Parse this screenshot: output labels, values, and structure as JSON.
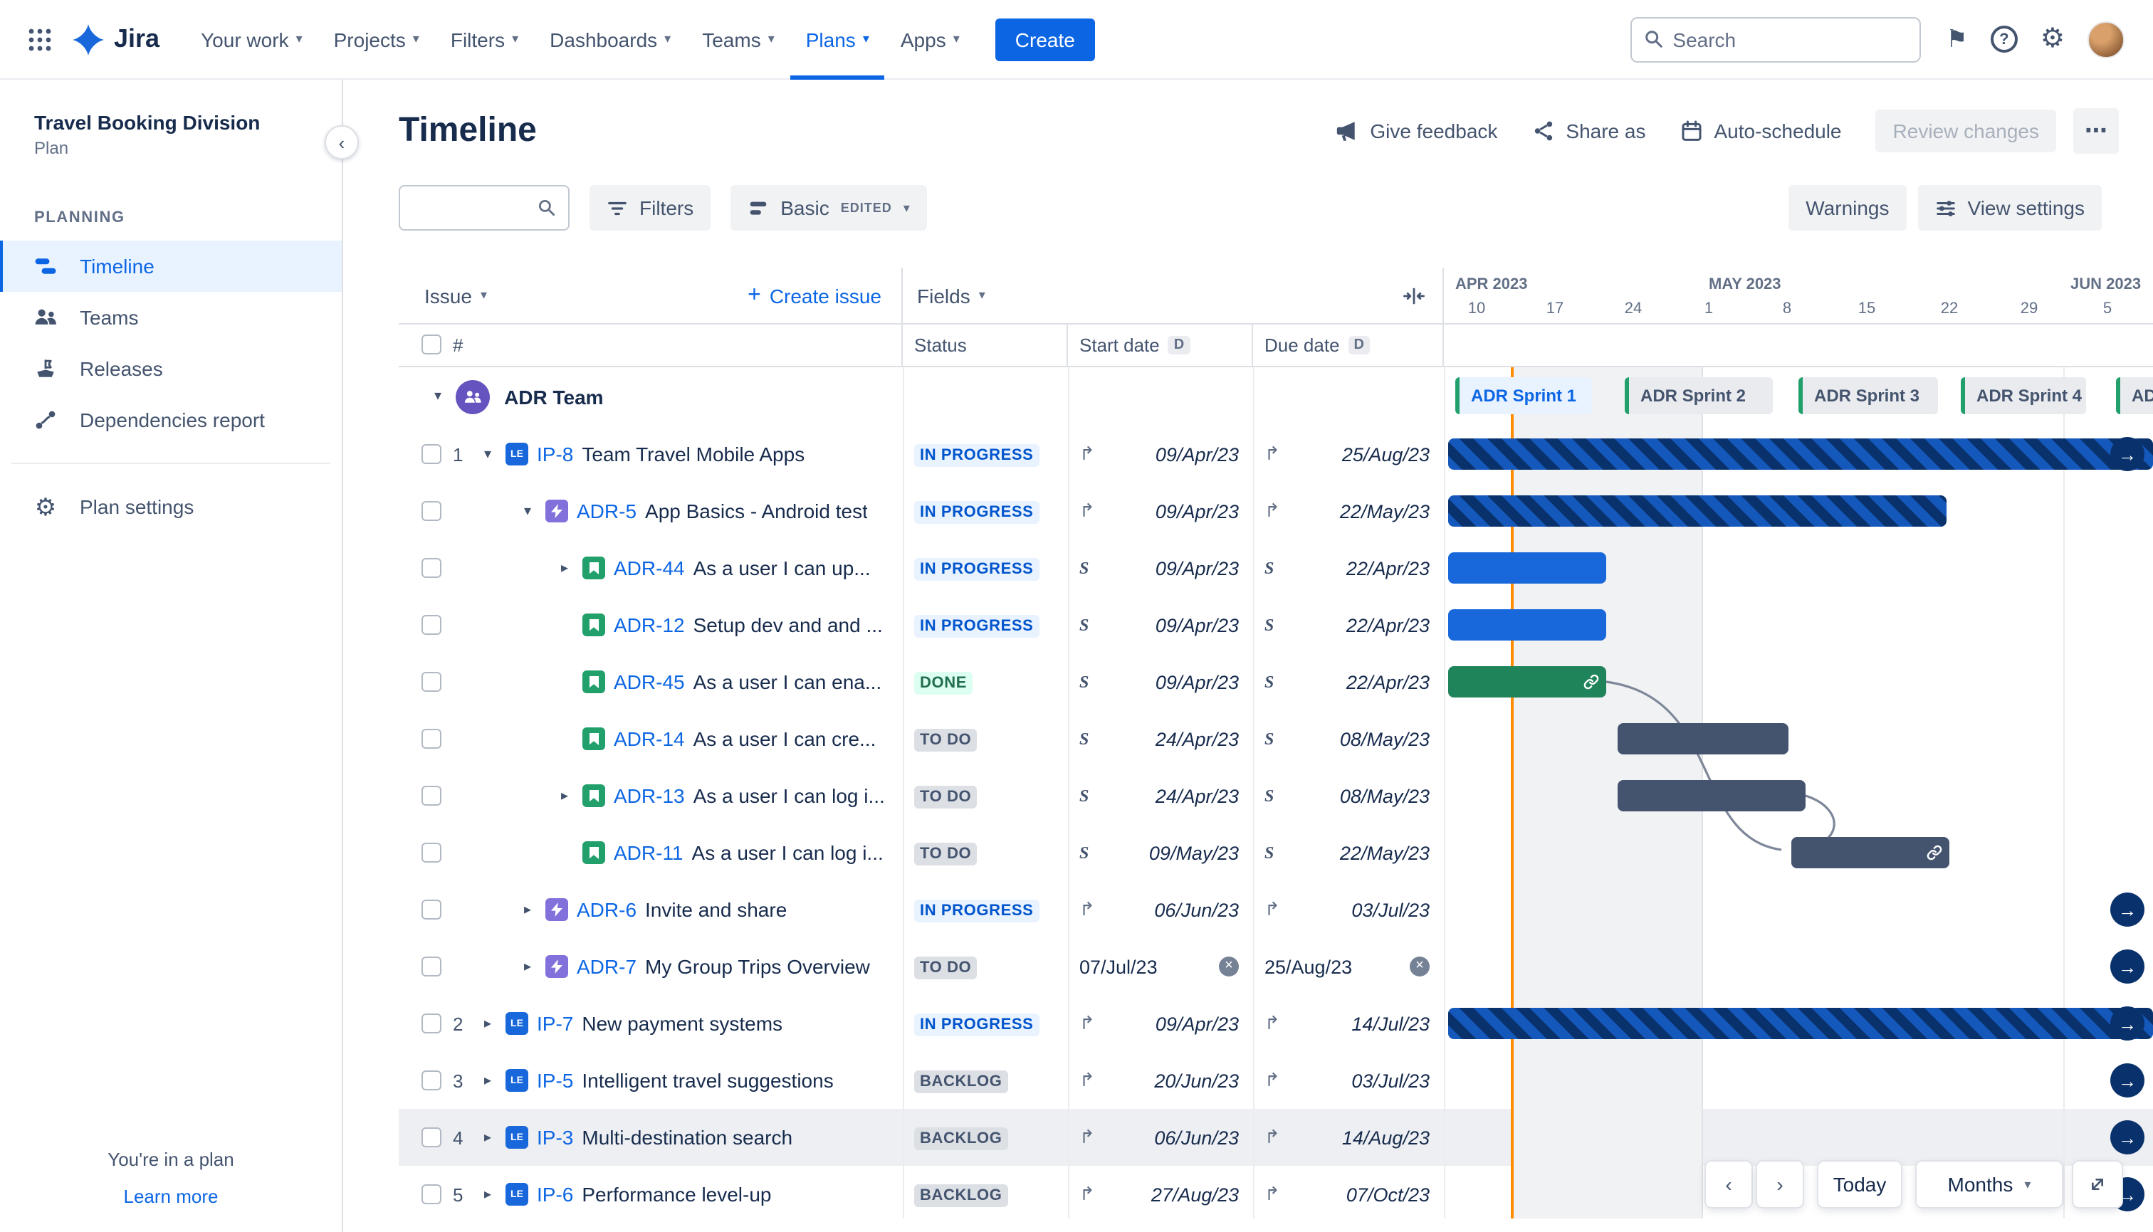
{
  "icons": {
    "chevron_down": "▾",
    "chevron_right": "▸",
    "collapse_panel": "‹",
    "nav_prev": "‹",
    "nav_next": "›",
    "arrow_right": "→",
    "rollup": "↱",
    "sprint": "S",
    "more": "⋯",
    "plus": "+",
    "flag": "⚑",
    "gear": "⚙",
    "help": "?",
    "remove": "×",
    "initiative_badge": "LE"
  },
  "colors": {
    "accent": "#0C66E4",
    "today_line": "#FF8B00",
    "bar_blue": "#1868DB",
    "bar_green": "#1F845A",
    "bar_slate": "#44546F",
    "bar_navy": "#09326C",
    "status_inprogress_bg": "#E9F2FF",
    "status_done_bg": "#DCFFF1",
    "status_neutral_bg": "#DCDFE4",
    "sprint_marker_green": "#22A06B"
  },
  "navbar": {
    "brand": "Jira",
    "items": [
      {
        "label": "Your work"
      },
      {
        "label": "Projects"
      },
      {
        "label": "Filters"
      },
      {
        "label": "Dashboards"
      },
      {
        "label": "Teams"
      },
      {
        "label": "Plans",
        "active": true
      },
      {
        "label": "Apps"
      }
    ],
    "create_label": "Create",
    "search_placeholder": "Search"
  },
  "sidebar": {
    "plan_name": "Travel Booking Division",
    "plan_type": "Plan",
    "section_label": "PLANNING",
    "items": [
      {
        "label": "Timeline",
        "selected": true
      },
      {
        "label": "Teams"
      },
      {
        "label": "Releases"
      },
      {
        "label": "Dependencies report"
      }
    ],
    "settings_label": "Plan settings",
    "footer_note": "You're in a plan",
    "footer_link": "Learn more"
  },
  "page": {
    "title": "Timeline",
    "give_feedback": "Give feedback",
    "share_as": "Share as",
    "auto_schedule": "Auto-schedule",
    "review_changes": "Review changes"
  },
  "toolbar": {
    "filters_label": "Filters",
    "view_mode_label": "Basic",
    "view_mode_badge": "EDITED",
    "warnings_label": "Warnings",
    "view_settings_label": "View settings"
  },
  "table": {
    "issue_header": "Issue",
    "create_issue_label": "Create issue",
    "fields_header": "Fields",
    "row_number_header": "#",
    "columns": {
      "status": "Status",
      "start": "Start date",
      "due": "Due date",
      "derived_badge": "D"
    }
  },
  "timeline": {
    "months": [
      {
        "label": "APR 2023",
        "ticks": [
          "10",
          "17",
          "24"
        ]
      },
      {
        "label": "MAY 2023",
        "ticks": [
          "1",
          "8",
          "15",
          "22",
          "29"
        ]
      },
      {
        "label": "JUN 2023",
        "ticks": [
          "5"
        ]
      }
    ],
    "sprints": [
      {
        "label": "ADR Sprint 1"
      },
      {
        "label": "ADR Sprint 2"
      },
      {
        "label": "ADR Sprint 3"
      },
      {
        "label": "ADR Sprint 4"
      },
      {
        "label": "AD"
      }
    ]
  },
  "group": {
    "name": "ADR Team"
  },
  "rows": [
    {
      "num": "1",
      "key": "IP-8",
      "title": "Team Travel Mobile Apps",
      "status": "IN PROGRESS",
      "start": "09/Apr/23",
      "due": "25/Aug/23"
    },
    {
      "num": "",
      "key": "ADR-5",
      "title": "App Basics - Android test",
      "status": "IN PROGRESS",
      "start": "09/Apr/23",
      "due": "22/May/23"
    },
    {
      "num": "",
      "key": "ADR-44",
      "title": "As a user I can up...",
      "status": "IN PROGRESS",
      "start": "09/Apr/23",
      "due": "22/Apr/23"
    },
    {
      "num": "",
      "key": "ADR-12",
      "title": "Setup dev and and ...",
      "status": "IN PROGRESS",
      "start": "09/Apr/23",
      "due": "22/Apr/23"
    },
    {
      "num": "",
      "key": "ADR-45",
      "title": "As a user I can ena...",
      "status": "DONE",
      "start": "09/Apr/23",
      "due": "22/Apr/23"
    },
    {
      "num": "",
      "key": "ADR-14",
      "title": "As a user I can cre...",
      "status": "TO DO",
      "start": "24/Apr/23",
      "due": "08/May/23"
    },
    {
      "num": "",
      "key": "ADR-13",
      "title": "As a user I can log i...",
      "status": "TO DO",
      "start": "24/Apr/23",
      "due": "08/May/23"
    },
    {
      "num": "",
      "key": "ADR-11",
      "title": "As a user I can log i...",
      "status": "TO DO",
      "start": "09/May/23",
      "due": "22/May/23"
    },
    {
      "num": "",
      "key": "ADR-6",
      "title": "Invite and share",
      "status": "IN PROGRESS",
      "start": "06/Jun/23",
      "due": "03/Jul/23"
    },
    {
      "num": "",
      "key": "ADR-7",
      "title": "My Group Trips Overview",
      "status": "TO DO",
      "start": "07/Jul/23",
      "due": "25/Aug/23"
    },
    {
      "num": "2",
      "key": "IP-7",
      "title": "New payment systems",
      "status": "IN PROGRESS",
      "start": "09/Apr/23",
      "due": "14/Jul/23"
    },
    {
      "num": "3",
      "key": "IP-5",
      "title": "Intelligent travel suggestions",
      "status": "BACKLOG",
      "start": "20/Jun/23",
      "due": "03/Jul/23"
    },
    {
      "num": "4",
      "key": "IP-3",
      "title": "Multi-destination search",
      "status": "BACKLOG",
      "start": "06/Jun/23",
      "due": "14/Aug/23"
    },
    {
      "num": "5",
      "key": "IP-6",
      "title": "Performance level-up",
      "status": "BACKLOG",
      "start": "27/Aug/23",
      "due": "07/Oct/23"
    }
  ],
  "chart_controls": {
    "today_label": "Today",
    "zoom_label": "Months"
  }
}
